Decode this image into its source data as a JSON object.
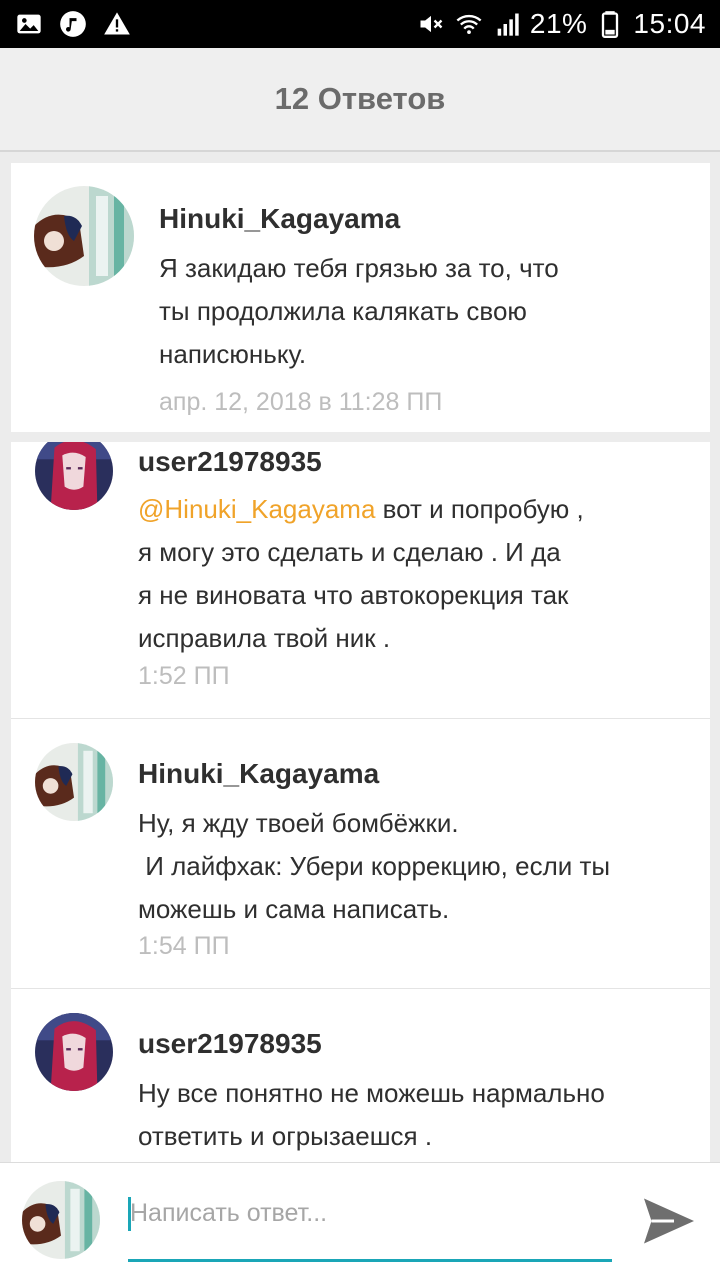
{
  "status_bar": {
    "battery": "21%",
    "time": "15:04",
    "icons": [
      "image-icon",
      "music-icon",
      "warning-icon",
      "mute-icon",
      "wifi-icon",
      "signal-icon",
      "battery-icon"
    ]
  },
  "header": {
    "title": "12 Ответов"
  },
  "parent": {
    "username": "Hinuki_Kagayama",
    "lines": [
      "Я закидаю тебя грязью за то, что",
      "ты продолжила калякать свою",
      "написюньку."
    ],
    "time": "апр. 12, 2018 в 11:28 ПП"
  },
  "replies": [
    {
      "username": "user21978935",
      "mention": "@Hinuki_Kagayama",
      "lines": [
        " вот и попробую ,",
        "я могу это сделать и сделаю . И да",
        "я не виновата что автокорекция так",
        "исправила твой ник ."
      ],
      "time": "1:52 ПП"
    },
    {
      "username": "Hinuki_Kagayama",
      "lines": [
        "Ну, я жду твоей бомбёжки.",
        " И лайфхак: Убери коррекцию, если ты",
        "можешь и сама написать."
      ],
      "time": "1:54 ПП"
    },
    {
      "username": "user21978935",
      "lines": [
        "Ну все понятно не можешь нармально",
        "ответить и огрызаешся ."
      ]
    }
  ],
  "input": {
    "placeholder": "Написать ответ..."
  },
  "colors": {
    "accent": "#1aa6b7",
    "mention": "#f0a329",
    "timestamp": "#bdbdbd"
  }
}
